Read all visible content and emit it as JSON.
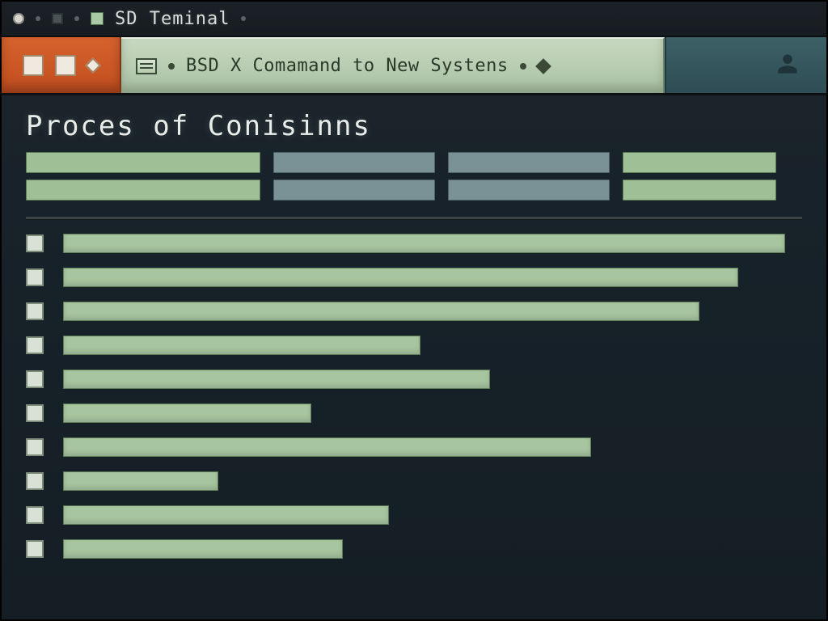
{
  "titlebar": {
    "title": "SD  Teminal"
  },
  "tab": {
    "label": "BSD X Comamand to New Systens"
  },
  "page": {
    "title": "Proces of Conisinns"
  },
  "header_grid": {
    "rows": 2,
    "cols": 4,
    "styles": [
      "g",
      "s",
      "s",
      "g",
      "g",
      "s",
      "s",
      "g"
    ]
  },
  "process_rows": [
    {
      "width_pct": 93
    },
    {
      "width_pct": 87
    },
    {
      "width_pct": 82
    },
    {
      "width_pct": 46
    },
    {
      "width_pct": 55
    },
    {
      "width_pct": 32
    },
    {
      "width_pct": 68
    },
    {
      "width_pct": 20
    },
    {
      "width_pct": 42
    },
    {
      "width_pct": 36
    }
  ],
  "colors": {
    "accent_green": "#a7c59f",
    "accent_slate": "#7a9196",
    "tab_orange": "#d6622e",
    "bg_dark": "#18222a"
  }
}
